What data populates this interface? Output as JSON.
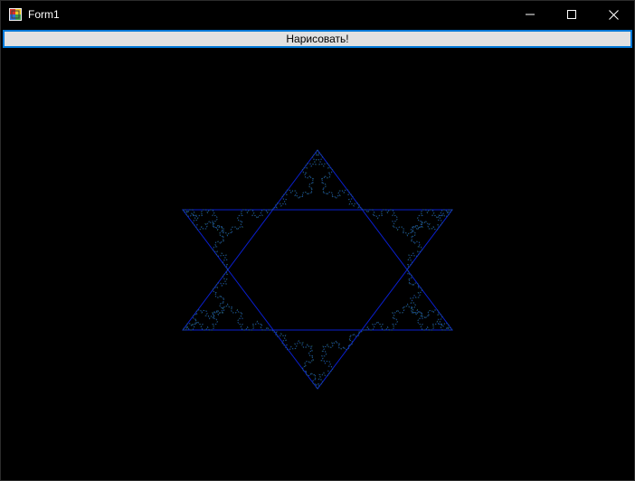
{
  "window": {
    "title": "Form1"
  },
  "caption": {
    "minimize_icon": "minimize-icon",
    "maximize_icon": "maximize-icon",
    "close_icon": "close-icon"
  },
  "toolbar": {
    "draw_label": "Нарисовать!"
  },
  "colors": {
    "background": "#000000",
    "fractal_stroke": "#0a1fd0",
    "fractal_dots": "#2f7a5a",
    "button_border": "#0078d7",
    "button_face": "#e1e1e1"
  },
  "drawing": {
    "figure": "koch-snowflake",
    "inner_shape": "star-of-david"
  }
}
